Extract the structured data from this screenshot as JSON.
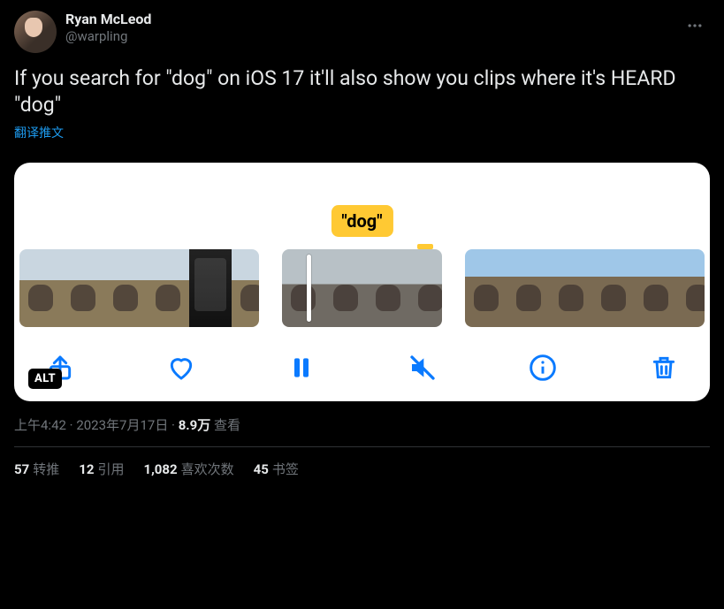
{
  "author": {
    "display_name": "Ryan McLeod",
    "handle": "@warpling"
  },
  "tweet_text": "If you search for \"dog\" on iOS 17 it'll also show you clips where it's HEARD \"dog\"",
  "translate_label": "翻译推文",
  "media": {
    "caption_chip": "\"dog\"",
    "alt_badge": "ALT"
  },
  "meta": {
    "time": "上午4:42",
    "date": "2023年7月17日",
    "views_count": "8.9万",
    "views_label": "查看"
  },
  "engagement": {
    "retweets_count": "57",
    "retweets_label": "转推",
    "quotes_count": "12",
    "quotes_label": "引用",
    "likes_count": "1,082",
    "likes_label": "喜欢次数",
    "bookmarks_count": "45",
    "bookmarks_label": "书签"
  }
}
